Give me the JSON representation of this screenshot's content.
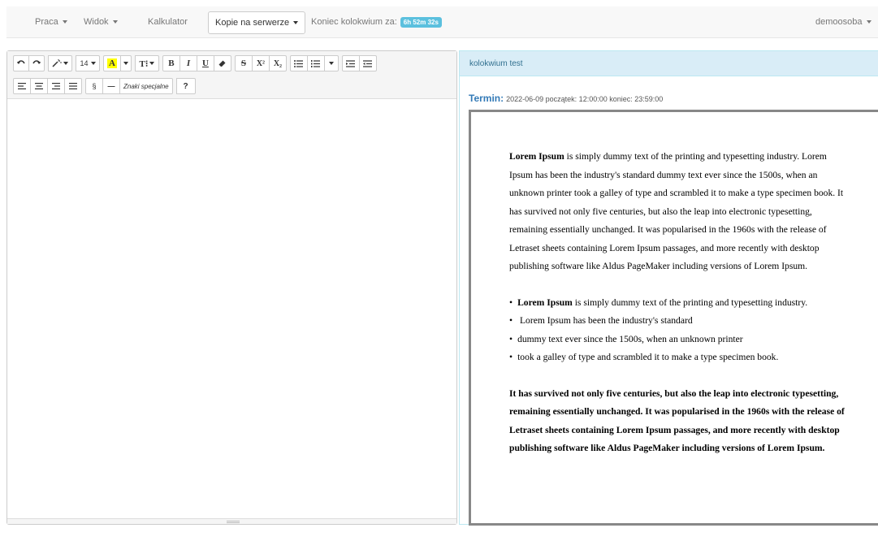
{
  "navbar": {
    "menu_praca": "Praca",
    "menu_widok": "Widok",
    "kalkulator": "Kalkulator",
    "server_copies": "Kopie na serwerze",
    "countdown_label": "Koniec kolokwium za:",
    "countdown_value": "6h 52m 32s",
    "user": "demoosoba"
  },
  "toolbar": {
    "font_size": "14",
    "highlight_letter": "A",
    "text_style": "T⁝",
    "bold": "B",
    "italic": "I",
    "underline": "U",
    "strike": "S",
    "superscript": "X²",
    "subscript": "X₂",
    "section": "§",
    "dash": "—",
    "special_chars": "Znaki specjalne",
    "help": "?"
  },
  "task": {
    "heading": "kolokwium test",
    "termin_label": "Termin:",
    "termin_value": "2022-06-09 początek: 12:00:00 koniec: 23:59:00",
    "para1_bold": "Lorem Ipsum",
    "para1_rest": " is simply dummy text of the printing and typesetting industry. Lorem Ipsum has been the industry's standard dummy text ever since the 1500s, when an unknown printer took a galley of type and scrambled it to make a type specimen book. It has survived not only five centuries, but also the leap into electronic typesetting, remaining essentially unchanged. It was popularised in the 1960s with the release of Letraset sheets containing Lorem Ipsum passages, and more recently with desktop publishing software like Aldus PageMaker including versions of Lorem Ipsum.",
    "bullet1_bold": "Lorem Ipsum",
    "bullet1_rest": " is simply dummy text of the printing and typesetting industry.",
    "bullet2": " Lorem Ipsum has been the industry's standard",
    "bullet3": "dummy text ever since the 1500s, when an unknown printer",
    "bullet4": "took a galley of type and scrambled it to make a type specimen book.",
    "para2": "It has survived not only five centuries, but also the leap into electronic typesetting, remaining essentially unchanged. It was popularised in the 1960s with the release of Letraset sheets containing Lorem Ipsum passages, and more recently with desktop publishing software like Aldus PageMaker including versions of Lorem Ipsum."
  }
}
